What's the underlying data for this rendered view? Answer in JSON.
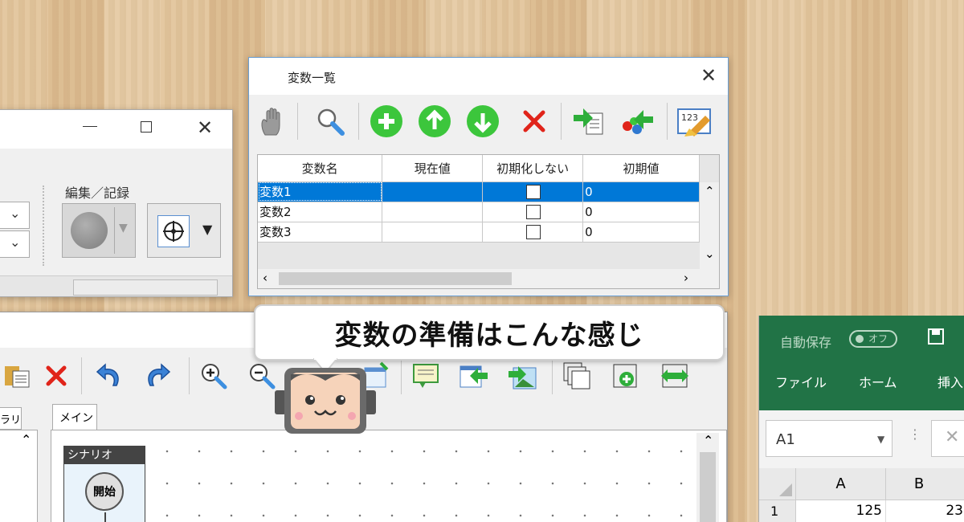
{
  "back_window": {
    "group_label": "編集／記録",
    "minimize_icon": "minimize-icon",
    "maximize_icon": "maximize-icon",
    "close_icon": "close-icon"
  },
  "var_window": {
    "title": "変数一覧",
    "toolbar": [
      "hand-icon",
      "search-icon",
      "add-icon",
      "move-up-icon",
      "move-down-icon",
      "delete-icon",
      "import-icon",
      "export-icon",
      "clear-icon"
    ],
    "columns": [
      "変数名",
      "現在値",
      "初期化しない",
      "初期値"
    ],
    "rows": [
      {
        "name": "変数1",
        "current": "",
        "no_init": false,
        "initial": "0"
      },
      {
        "name": "変数2",
        "current": "",
        "no_init": false,
        "initial": "0"
      },
      {
        "name": "変数3",
        "current": "",
        "no_init": false,
        "initial": "0"
      }
    ],
    "selected_row": 0
  },
  "main_window": {
    "tab_library": "ラリ",
    "tab_main": "メイン",
    "scenario_title": "シナリオ",
    "start_label": "開始"
  },
  "bubble_text": "変数の準備はこんな感じ",
  "excel": {
    "autosave": "自動保存",
    "autosave_toggle": "オフ",
    "ribbon_tabs": [
      "ファイル",
      "ホーム",
      "挿入"
    ],
    "name_box": "A1",
    "col_headers": [
      "A",
      "B"
    ],
    "row_headers": [
      "1"
    ],
    "cells": [
      "125",
      "23"
    ],
    "accent": "#217346"
  }
}
